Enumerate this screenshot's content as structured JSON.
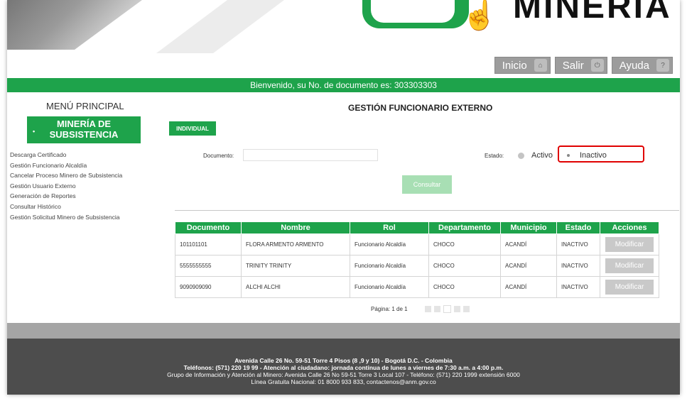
{
  "header": {
    "brand": "MINERÍA",
    "buttons": [
      {
        "label": "Inicio",
        "icon": "home-icon"
      },
      {
        "label": "Salir",
        "icon": "power-icon"
      },
      {
        "label": "Ayuda",
        "icon": "help-icon"
      }
    ]
  },
  "welcome": "Bienvenido, su No. de documento es: 303303303",
  "sidebar": {
    "title": "MENÚ PRINCIPAL",
    "section_line1": "MINERÍA DE",
    "section_line2": "SUBSISTENCIA",
    "items": [
      "Descarga Certificado",
      "Gestión Funcionario Alcaldía",
      "Cancelar Proceso Minero de Subsistencia",
      "Gestión Usuario Externo",
      "Generación de Reportes",
      "Consultar Histórico",
      "Gestión Solicitud Minero de Subsistencia"
    ]
  },
  "main": {
    "title": "GESTIÓN FUNCIONARIO EXTERNO",
    "tab": "INDIVIDUAL",
    "documento_label": "Documento:",
    "documento_value": "",
    "estado_label": "Estado:",
    "estado_options": [
      "Activo",
      "Inactivo"
    ],
    "estado_selected": "Inactivo",
    "consultar": "Consultar"
  },
  "table": {
    "headers": [
      "Documento",
      "Nombre",
      "Rol",
      "Departamento",
      "Municipio",
      "Estado",
      "Acciones"
    ],
    "rows": [
      [
        "101101101",
        "FLORA ARMENTO ARMENTO",
        "Funcionario Alcaldía",
        "CHOCO",
        "ACANDÍ",
        "INACTIVO",
        "Modificar"
      ],
      [
        "5555555555",
        "TRINITY TRINITY",
        "Funcionario Alcaldía",
        "CHOCO",
        "ACANDÍ",
        "INACTIVO",
        "Modificar"
      ],
      [
        "9090909090",
        "ALCHI ALCHI",
        "Funcionario Alcaldía",
        "CHOCO",
        "ACANDÍ",
        "INACTIVO",
        "Modificar"
      ]
    ],
    "pagination": "Página: 1 de 1"
  },
  "footer": {
    "line1": "Avenida Calle 26 No. 59-51 Torre 4 Pisos (8 ,9 y 10) - Bogotá D.C. - Colombia",
    "line2": "Teléfonos: (571) 220 19 99 - Atención al ciudadano: jornada continua de lunes a viernes de 7:30 a.m. a 4:00 p.m.",
    "line3": "Grupo de Información y Atención al Minero: Avenida Calle 26 No 59-51 Torre 3 Local 107 - Teléfono: (571) 220 1999 extensión 6000",
    "line4": "Línea Gratuita Nacional: 01 8000 933 833, contactenos@anm.gov.co"
  },
  "colors": {
    "green": "#1ea34b",
    "highlight": "#e00000"
  }
}
